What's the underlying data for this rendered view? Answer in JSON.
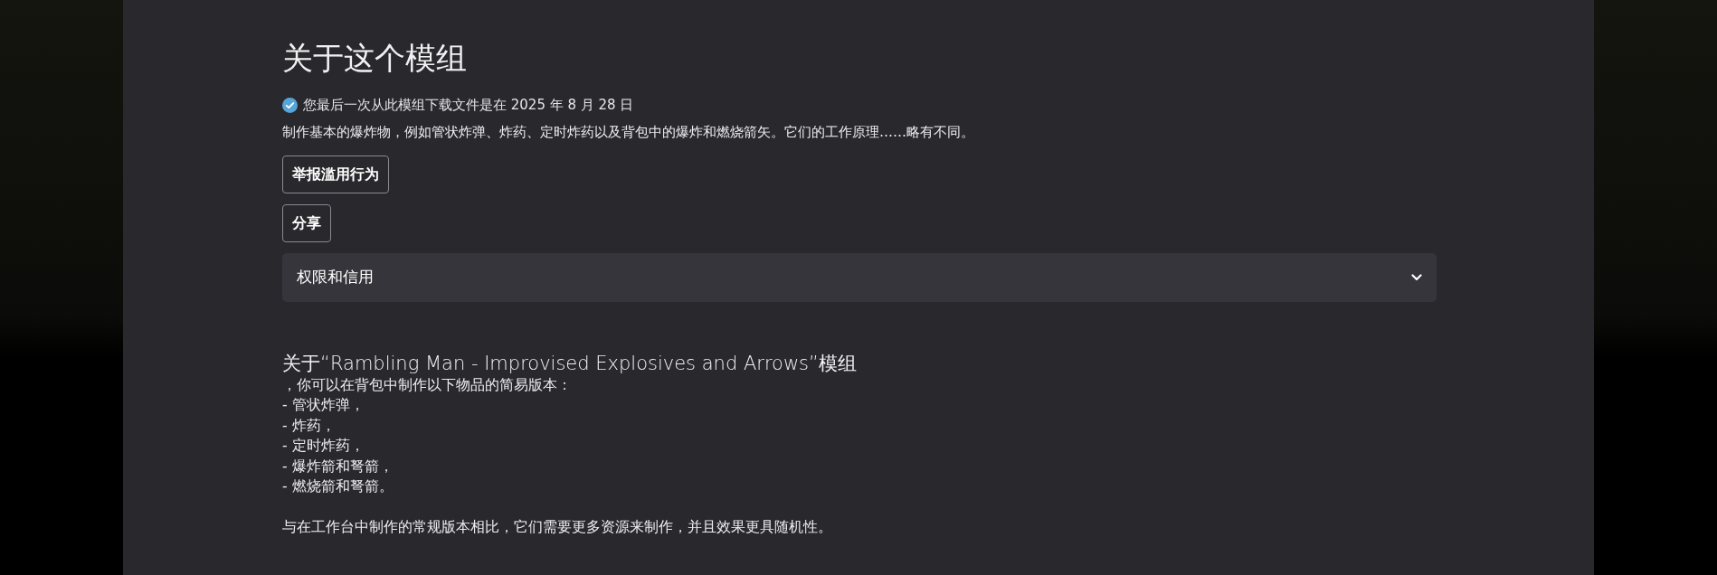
{
  "title": "关于这个模组",
  "download_notice": {
    "text": "您最后一次从此模组下载文件是在 2025 年 8 月 28 日",
    "verified": true
  },
  "description": "制作基本的爆炸物，例如管状炸弹、炸药、定时炸药以及背包中的爆炸和燃烧箭矢。它们的工作原理……略有不同。",
  "buttons": [
    "举报滥用行为",
    "分享"
  ],
  "accordion": {
    "title": "权限和信用",
    "expanded": false
  },
  "about": {
    "heading": "关于“Rambling Man - Improvised Explosives and Arrows”模组",
    "paragraphs": [
      {
        "lines": [
          "，你可以在背包中制作以下物品的简易版本：",
          "- 管状炸弹，",
          "- 炸药，",
          "- 定时炸药，",
          "- 爆炸箭和弩箭，",
          "- 燃烧箭和弩箭。"
        ]
      },
      {
        "lines": [
          "与在工作台中制作的常规版本相比，它们需要更多资源来制作，并且效果更具随机性。"
        ]
      }
    ]
  }
}
